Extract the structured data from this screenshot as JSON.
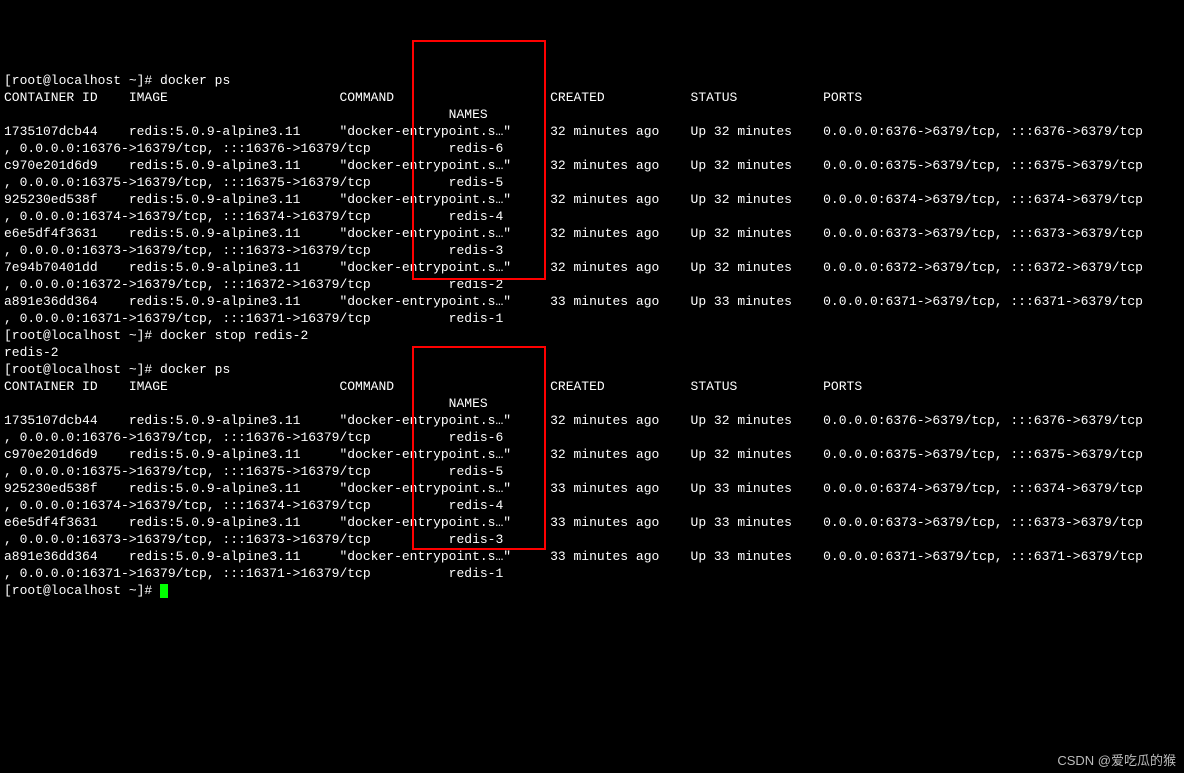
{
  "prompt": "[root@localhost ~]# ",
  "cmd_ps": "docker ps",
  "cmd_stop": "docker stop redis-2",
  "stop_output": "redis-2",
  "header": {
    "container_id": "CONTAINER ID",
    "image": "IMAGE",
    "command": "COMMAND",
    "created": "CREATED",
    "status": "STATUS",
    "ports": "PORTS",
    "names": "NAMES"
  },
  "ps1": [
    {
      "id": "1735107dcb44",
      "image": "redis:5.0.9-alpine3.11",
      "command": "\"docker-entrypoint.s…\"",
      "created": "32 minutes ago",
      "status": "Up 32 minutes",
      "port_a": "0.0.0.0:6376->6379/tcp, :::6376->6379/tcp",
      "port_b": "0.0.0.0:16376->16379/tcp, :::16376->16379/tcp",
      "name": "redis-6"
    },
    {
      "id": "c970e201d6d9",
      "image": "redis:5.0.9-alpine3.11",
      "command": "\"docker-entrypoint.s…\"",
      "created": "32 minutes ago",
      "status": "Up 32 minutes",
      "port_a": "0.0.0.0:6375->6379/tcp, :::6375->6379/tcp",
      "port_b": "0.0.0.0:16375->16379/tcp, :::16375->16379/tcp",
      "name": "redis-5"
    },
    {
      "id": "925230ed538f",
      "image": "redis:5.0.9-alpine3.11",
      "command": "\"docker-entrypoint.s…\"",
      "created": "32 minutes ago",
      "status": "Up 32 minutes",
      "port_a": "0.0.0.0:6374->6379/tcp, :::6374->6379/tcp",
      "port_b": "0.0.0.0:16374->16379/tcp, :::16374->16379/tcp",
      "name": "redis-4"
    },
    {
      "id": "e6e5df4f3631",
      "image": "redis:5.0.9-alpine3.11",
      "command": "\"docker-entrypoint.s…\"",
      "created": "32 minutes ago",
      "status": "Up 32 minutes",
      "port_a": "0.0.0.0:6373->6379/tcp, :::6373->6379/tcp",
      "port_b": "0.0.0.0:16373->16379/tcp, :::16373->16379/tcp",
      "name": "redis-3"
    },
    {
      "id": "7e94b70401dd",
      "image": "redis:5.0.9-alpine3.11",
      "command": "\"docker-entrypoint.s…\"",
      "created": "32 minutes ago",
      "status": "Up 32 minutes",
      "port_a": "0.0.0.0:6372->6379/tcp, :::6372->6379/tcp",
      "port_b": "0.0.0.0:16372->16379/tcp, :::16372->16379/tcp",
      "name": "redis-2"
    },
    {
      "id": "a891e36dd364",
      "image": "redis:5.0.9-alpine3.11",
      "command": "\"docker-entrypoint.s…\"",
      "created": "33 minutes ago",
      "status": "Up 33 minutes",
      "port_a": "0.0.0.0:6371->6379/tcp, :::6371->6379/tcp",
      "port_b": "0.0.0.0:16371->16379/tcp, :::16371->16379/tcp",
      "name": "redis-1"
    }
  ],
  "ps2": [
    {
      "id": "1735107dcb44",
      "image": "redis:5.0.9-alpine3.11",
      "command": "\"docker-entrypoint.s…\"",
      "created": "32 minutes ago",
      "status": "Up 32 minutes",
      "port_a": "0.0.0.0:6376->6379/tcp, :::6376->6379/tcp",
      "port_b": "0.0.0.0:16376->16379/tcp, :::16376->16379/tcp",
      "name": "redis-6"
    },
    {
      "id": "c970e201d6d9",
      "image": "redis:5.0.9-alpine3.11",
      "command": "\"docker-entrypoint.s…\"",
      "created": "32 minutes ago",
      "status": "Up 32 minutes",
      "port_a": "0.0.0.0:6375->6379/tcp, :::6375->6379/tcp",
      "port_b": "0.0.0.0:16375->16379/tcp, :::16375->16379/tcp",
      "name": "redis-5"
    },
    {
      "id": "925230ed538f",
      "image": "redis:5.0.9-alpine3.11",
      "command": "\"docker-entrypoint.s…\"",
      "created": "33 minutes ago",
      "status": "Up 33 minutes",
      "port_a": "0.0.0.0:6374->6379/tcp, :::6374->6379/tcp",
      "port_b": "0.0.0.0:16374->16379/tcp, :::16374->16379/tcp",
      "name": "redis-4"
    },
    {
      "id": "e6e5df4f3631",
      "image": "redis:5.0.9-alpine3.11",
      "command": "\"docker-entrypoint.s…\"",
      "created": "33 minutes ago",
      "status": "Up 33 minutes",
      "port_a": "0.0.0.0:6373->6379/tcp, :::6373->6379/tcp",
      "port_b": "0.0.0.0:16373->16379/tcp, :::16373->16379/tcp",
      "name": "redis-3"
    },
    {
      "id": "a891e36dd364",
      "image": "redis:5.0.9-alpine3.11",
      "command": "\"docker-entrypoint.s…\"",
      "created": "33 minutes ago",
      "status": "Up 33 minutes",
      "port_a": "0.0.0.0:6371->6379/tcp, :::6371->6379/tcp",
      "port_b": "0.0.0.0:16371->16379/tcp, :::16371->16379/tcp",
      "name": "redis-1"
    }
  ],
  "watermark": "CSDN @爱吃瓜的猴"
}
